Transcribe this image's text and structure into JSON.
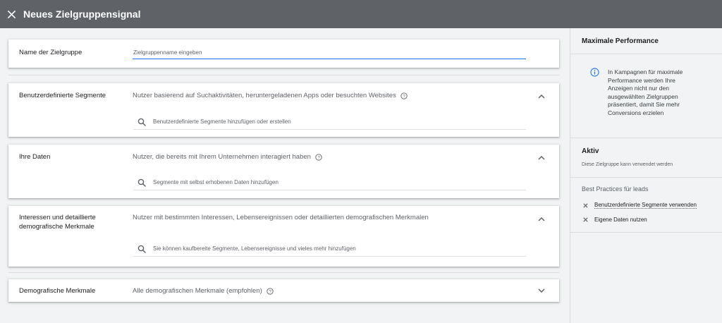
{
  "header": {
    "title": "Neues Zielgruppensignal",
    "close_icon": "close-icon",
    "bg_color": "#5f6368"
  },
  "name_section": {
    "label": "Name der Zielgruppe",
    "placeholder": "Zielgruppenname eingeben",
    "value": ""
  },
  "segments": [
    {
      "label": "Benutzerdefinierte Segmente",
      "description": "Nutzer basierend auf Suchaktivitäten, heruntergeladenen Apps oder besuchten Websites",
      "search_placeholder": "Benutzerdefinierte Segmente hinzufügen oder erstellen",
      "expanded": true
    },
    {
      "label": "Ihre Daten",
      "description": "Nutzer, die bereits mit Ihrem Unternehmen interagiert haben",
      "search_placeholder": "Segmente mit selbst erhobenen Daten hinzufügen",
      "expanded": true
    },
    {
      "label_line1": "Interessen und detaillierte",
      "label_line2": "demografische Merkmale",
      "description": "Nutzer mit bestimmten Interessen, Lebensereignissen oder detaillierten demografischen Merkmalen",
      "search_placeholder": "Sie können kaufbereite Segmente, Lebensereignisse und vieles mehr hinzufügen",
      "expanded": true
    },
    {
      "label": "Demografische Merkmale",
      "description": "Alle demografischen Merkmale (empfohlen)",
      "expanded": false
    }
  ],
  "sidebar": {
    "title": "Maximale Performance",
    "info_text": "In Kampagnen für maximale Performance werden Ihre Anzeigen nicht nur den ausgewählten Zielgruppen präsentiert, damit Sie mehr Conversions erzielen",
    "status_title": "Aktiv",
    "status_text": "Diese Zielgruppe kann verwendet werden",
    "best_practices_title": "Best Practices für leads",
    "best_practices": [
      "Benutzerdefinierte Segmente verwenden",
      "Eigene Daten nutzen"
    ],
    "info_color": "#1a73e8"
  }
}
